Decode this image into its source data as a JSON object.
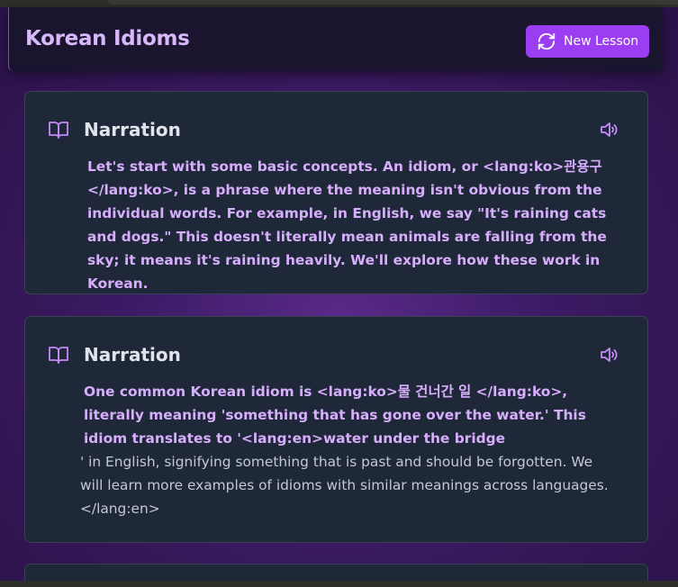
{
  "header": {
    "title": "Korean Idioms",
    "new_lesson_label": "New Lesson"
  },
  "cards": [
    {
      "title": "Narration",
      "icon": "book-open-icon",
      "text": "Let's start with some basic concepts. An idiom, or <lang:ko>관용구 </lang:ko>, is a phrase where the meaning isn't obvious from the individual words. For example, in English, we say \"It's raining cats and dogs.\" This doesn't literally mean animals are falling from the sky; it means it's raining heavily. We'll explore how these work in Korean."
    },
    {
      "title": "Narration",
      "icon": "book-open-icon",
      "text_highlight": "One common Korean idiom is <lang:ko>물 건너간 일 </lang:ko>, literally meaning 'something that has gone over the water.' This idiom translates to '<lang:en>water under the bridge",
      "text_plain": "' in English, signifying something that is past and should be forgotten. We will learn more examples of idioms with similar meanings across languages. </lang:en>"
    }
  ],
  "colors": {
    "accent": "#9b3df2",
    "title_purple": "#d7b8fb",
    "highlight_text": "#d6aefc",
    "card_bg": "#1f2838"
  }
}
